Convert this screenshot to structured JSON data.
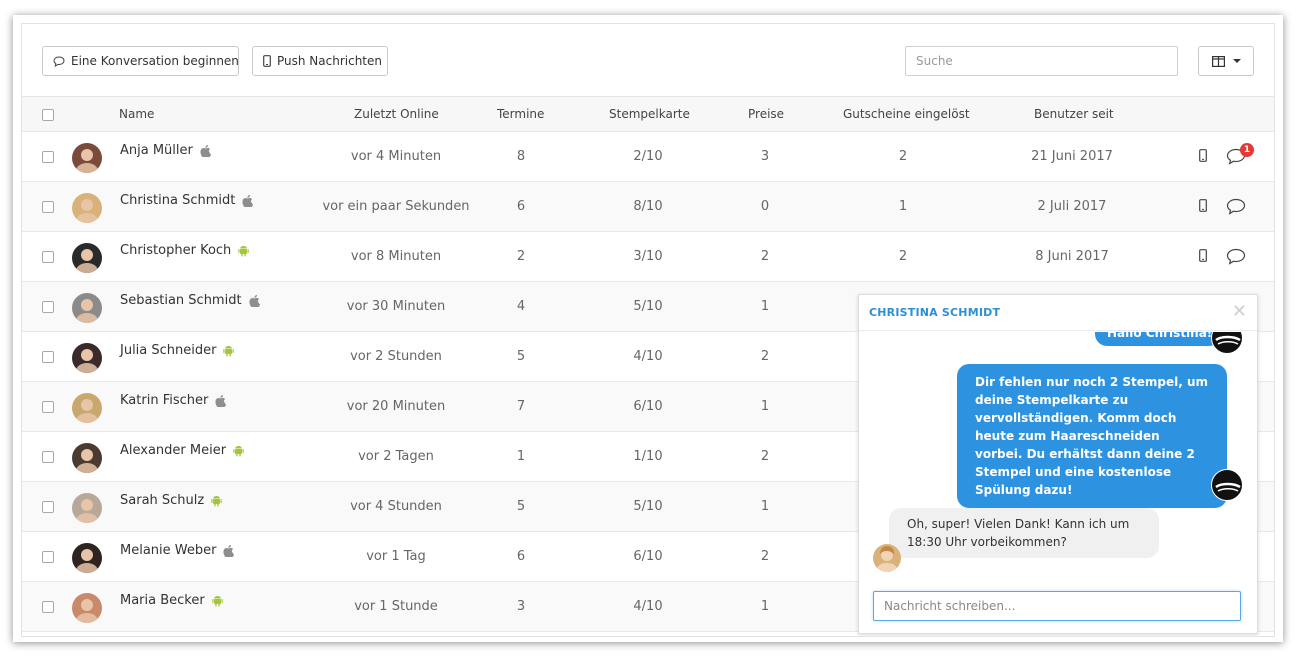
{
  "toolbar": {
    "conversation_label": "Eine Konversation beginnen",
    "push_label": "Push Nachrichten",
    "search_placeholder": "Suche"
  },
  "columns": {
    "name": "Name",
    "last_online": "Zuletzt Online",
    "appointments": "Termine",
    "stamp_card": "Stempelkarte",
    "prizes": "Preise",
    "vouchers": "Gutscheine eingelöst",
    "user_since": "Benutzer seit"
  },
  "rows": [
    {
      "name": "Anja Müller",
      "platform": "apple-icon",
      "last_online": "vor 4 Minuten",
      "appointments": "8",
      "stamp_card": "2/10",
      "prizes": "3",
      "vouchers": "2",
      "user_since": "21 Juni 2017",
      "unread": "1",
      "avatar_color": "#7a4a3a"
    },
    {
      "name": "Christina Schmidt",
      "platform": "apple-icon",
      "last_online": "vor ein paar Sekunden",
      "appointments": "6",
      "stamp_card": "8/10",
      "prizes": "0",
      "vouchers": "1",
      "user_since": "2 Juli 2017",
      "avatar_color": "#d9b27a"
    },
    {
      "name": "Christopher Koch",
      "platform": "android-icon",
      "last_online": "vor 8 Minuten",
      "appointments": "2",
      "stamp_card": "3/10",
      "prizes": "2",
      "vouchers": "2",
      "user_since": "8 Juni 2017",
      "avatar_color": "#2a2a2a"
    },
    {
      "name": "Sebastian Schmidt",
      "platform": "apple-icon",
      "last_online": "vor 30 Minuten",
      "appointments": "4",
      "stamp_card": "5/10",
      "prizes": "1",
      "avatar_color": "#8b8b8b"
    },
    {
      "name": "Julia Schneider",
      "platform": "android-icon",
      "last_online": "vor 2 Stunden",
      "appointments": "5",
      "stamp_card": "4/10",
      "prizes": "2",
      "avatar_color": "#3a2a2a"
    },
    {
      "name": "Katrin Fischer",
      "platform": "apple-icon",
      "last_online": "vor 20 Minuten",
      "appointments": "7",
      "stamp_card": "6/10",
      "prizes": "1",
      "avatar_color": "#c9a870"
    },
    {
      "name": "Alexander Meier",
      "platform": "android-icon",
      "last_online": "vor 2 Tagen",
      "appointments": "1",
      "stamp_card": "1/10",
      "prizes": "2",
      "avatar_color": "#4a3a30"
    },
    {
      "name": "Sarah Schulz",
      "platform": "android-icon",
      "last_online": "vor 4 Stunden",
      "appointments": "5",
      "stamp_card": "5/10",
      "prizes": "1",
      "avatar_color": "#b8a89a"
    },
    {
      "name": "Melanie Weber",
      "platform": "apple-icon",
      "last_online": "vor 1 Tag",
      "appointments": "6",
      "stamp_card": "6/10",
      "prizes": "2",
      "avatar_color": "#2e2420"
    },
    {
      "name": "Maria Becker",
      "platform": "android-icon",
      "last_online": "vor 1 Stunde",
      "appointments": "3",
      "stamp_card": "4/10",
      "prizes": "1",
      "avatar_color": "#c98a6a"
    }
  ],
  "chat": {
    "title": "CHRISTINA SCHMIDT",
    "partial_message": "Hallo Christina!",
    "outgoing_message": "Dir fehlen nur noch 2 Stempel, um deine Stempelkarte zu vervollständigen. Komm doch heute zum Haareschneiden  vorbei. Du erhältst dann deine 2 Stempel und eine kostenlose Spülung dazu!",
    "incoming_message": "Oh, super! Vielen Dank! Kann ich um 18:30 Uhr vorbeikommen?",
    "input_placeholder": "Nachricht schreiben..."
  },
  "colors": {
    "accent": "#2d93e0",
    "android": "#a4c639",
    "apple": "#8e8e8e",
    "badge": "#e53935"
  }
}
